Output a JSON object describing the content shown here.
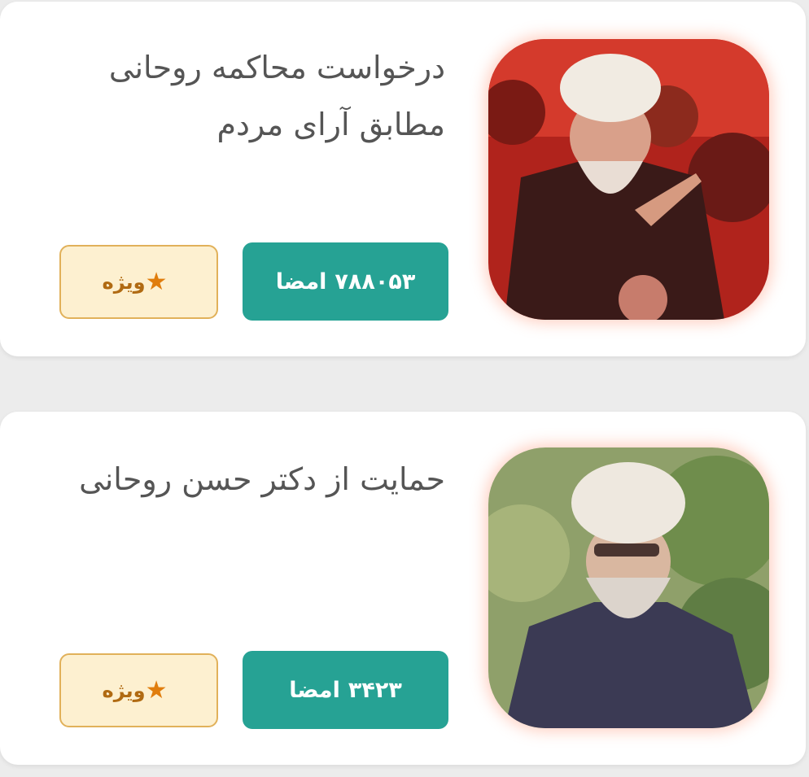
{
  "petitions": [
    {
      "title_lines": [
        "درخواست محاکمه روحانی",
        "مطابق آرای مردم"
      ],
      "signatures": "۷۸۸۰۵۳",
      "signatures_label": "امضا",
      "featured_label": "ویژه",
      "featured_icon": "star-icon"
    },
    {
      "title_lines": [
        "حمایت از دکتر حسن روحانی"
      ],
      "signatures": "۳۴۲۳",
      "signatures_label": "امضا",
      "featured_label": "ویژه",
      "featured_icon": "star-icon"
    }
  ],
  "colors": {
    "sign_button": "#26a294",
    "featured_bg": "#fdf0d0",
    "featured_border": "#e1b15a",
    "featured_star": "#e07d0d"
  }
}
